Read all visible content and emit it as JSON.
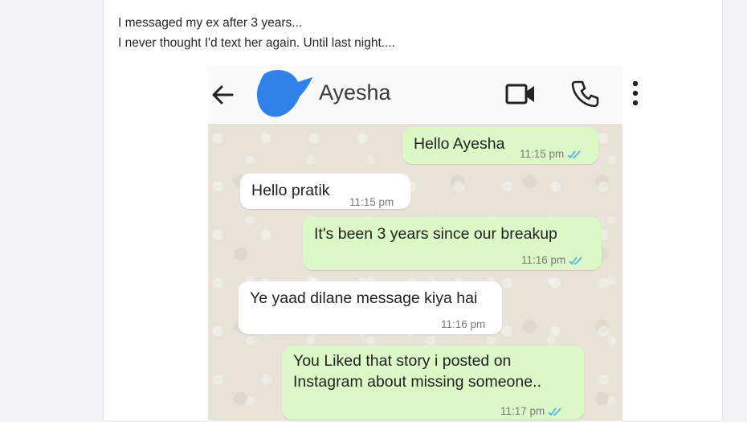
{
  "post": {
    "caption_lines": [
      "I messaged my ex after 3 years...",
      "I never thought I'd text her again. Until last night...."
    ]
  },
  "chat": {
    "contact_name": "Ayesha",
    "colors": {
      "outgoing_bubble": "#dcf8c6",
      "incoming_bubble": "#ffffff",
      "read_ticks": "#4fb6ec"
    },
    "icons": [
      "back-arrow-icon",
      "video-call-icon",
      "phone-icon",
      "more-options-icon"
    ],
    "messages": [
      {
        "direction": "out",
        "text": "Hello Ayesha",
        "time": "11:15 pm",
        "status": "read"
      },
      {
        "direction": "in",
        "text": "Hello pratik",
        "time": "11:15 pm"
      },
      {
        "direction": "out",
        "text": "It's been 3 years since our breakup",
        "time": "11:16 pm",
        "status": "read"
      },
      {
        "direction": "in",
        "text": "Ye yaad dilane message kiya hai",
        "time": "11:16 pm"
      },
      {
        "direction": "out",
        "text_lines": [
          "You Liked that story i posted on",
          "Instagram about missing someone.."
        ],
        "time": "11:17 pm",
        "status": "read"
      }
    ]
  }
}
